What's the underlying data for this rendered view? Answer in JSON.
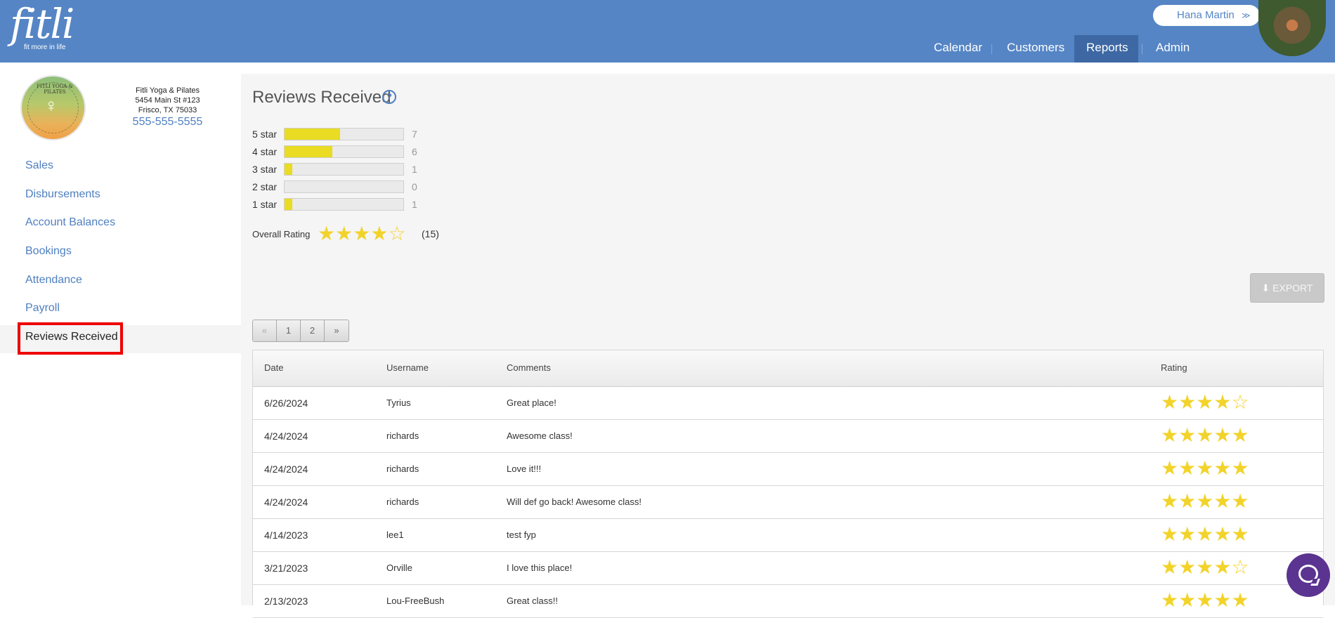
{
  "brand": {
    "logo_word": "fitli",
    "logo_tagline": "fit more in life"
  },
  "user": {
    "name": "Hana Martin"
  },
  "nav": [
    "Calendar",
    "Customers",
    "Reports",
    "Admin"
  ],
  "studio": {
    "logo_text": "FITLI YOGA & PILATES",
    "name": "Fitli Yoga & Pilates",
    "address1": "5454 Main St #123",
    "address2": "Frisco, TX 75033",
    "phone": "555-555-5555"
  },
  "sidebar": {
    "items": [
      "Sales",
      "Disbursements",
      "Account Balances",
      "Bookings",
      "Attendance",
      "Payroll",
      "Reviews Received"
    ],
    "active": "Reviews Received"
  },
  "page": {
    "title": "Reviews Received"
  },
  "distribution": [
    {
      "label": "5 star",
      "count": "7",
      "fraction": 0.4667
    },
    {
      "label": "4 star",
      "count": "6",
      "fraction": 0.4
    },
    {
      "label": "3 star",
      "count": "1",
      "fraction": 0.0667
    },
    {
      "label": "2 star",
      "count": "0",
      "fraction": 0
    },
    {
      "label": "1 star",
      "count": "1",
      "fraction": 0.0667
    }
  ],
  "overall": {
    "label": "Overall Rating",
    "stars": 4,
    "max_stars": 5,
    "count": "(15)"
  },
  "export_label": "EXPORT",
  "pagination": [
    "«",
    "1",
    "2",
    "»"
  ],
  "table": {
    "columns": [
      "Date",
      "Username",
      "Comments",
      "Rating"
    ],
    "rows": [
      {
        "date": "6/26/2024",
        "username": "Tyrius",
        "comment": "Great place!",
        "rating": 4
      },
      {
        "date": "4/24/2024",
        "username": "richards",
        "comment": "Awesome class!",
        "rating": 5
      },
      {
        "date": "4/24/2024",
        "username": "richards",
        "comment": "Love it!!!",
        "rating": 5
      },
      {
        "date": "4/24/2024",
        "username": "richards",
        "comment": "Will def go back! Awesome class!",
        "rating": 5
      },
      {
        "date": "4/14/2023",
        "username": "lee1",
        "comment": "test fyp",
        "rating": 5
      },
      {
        "date": "3/21/2023",
        "username": "Orville",
        "comment": "I love this place!",
        "rating": 4
      },
      {
        "date": "2/13/2023",
        "username": "Lou-FreeBush",
        "comment": "Great class!!",
        "rating": 5
      }
    ]
  },
  "colors": {
    "header_blue": "#5585c5",
    "nav_active": "#3d68a3",
    "link_blue": "#4f7fc0",
    "star_yellow": "#f2d32a",
    "bar_yellow": "#e9dc22",
    "highlight_red": "#ee0000",
    "chat_purple": "#5b3390"
  }
}
